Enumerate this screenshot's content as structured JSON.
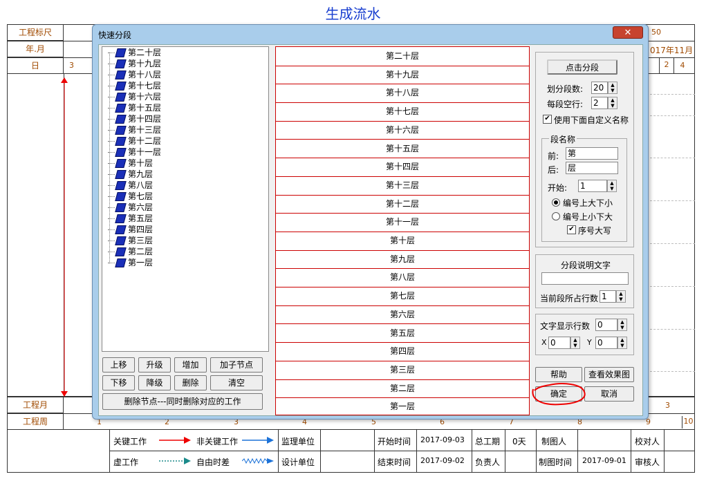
{
  "background": {
    "title": "生成流水",
    "header_labels": [
      "工程标尺",
      "年.月",
      "日"
    ],
    "footer_labels": [
      "工程月",
      "工程周"
    ],
    "header_right": {
      "scale_end": "50",
      "month": "017年11月"
    },
    "day_values": {
      "left": "3",
      "right_a": "2",
      "right_b": "4"
    },
    "month_right": "3",
    "week_numbers": [
      "1",
      "2",
      "3",
      "4",
      "5",
      "6",
      "7",
      "8",
      "9",
      "10"
    ],
    "legend": {
      "critical": "关键工作",
      "noncritical": "非关键工作",
      "dummy": "虚工作",
      "free_float": "自由时差"
    },
    "info": {
      "supervisor_label": "监理单位",
      "designer_label": "设计单位",
      "start_label": "开始时间",
      "start_value": "2017-09-03",
      "end_label": "结束时间",
      "end_value": "2017-09-02",
      "total_label": "总工期",
      "total_value": "0天",
      "owner_label": "负责人",
      "drafter_label": "制图人",
      "draw_time_label": "制图时间",
      "draw_time_value": "2017-09-01",
      "checker_label": "校对人",
      "reviewer_label": "审核人"
    }
  },
  "dialog": {
    "title": "快速分段",
    "close_glyph": "✕",
    "tree_items": [
      "第二十层",
      "第十九层",
      "第十八层",
      "第十七层",
      "第十六层",
      "第十五层",
      "第十四层",
      "第十三层",
      "第十二层",
      "第十一层",
      "第十层",
      "第九层",
      "第八层",
      "第七层",
      "第六层",
      "第五层",
      "第四层",
      "第三层",
      "第二层",
      "第一层"
    ],
    "segments": [
      "第二十层",
      "第十九层",
      "第十八层",
      "第十七层",
      "第十六层",
      "第十五层",
      "第十四层",
      "第十三层",
      "第十二层",
      "第十一层",
      "第十层",
      "第九层",
      "第八层",
      "第七层",
      "第六层",
      "第五层",
      "第四层",
      "第三层",
      "第二层",
      "第一层"
    ],
    "buttons": {
      "up": "上移",
      "promote": "升级",
      "add": "增加",
      "add_child": "加子节点",
      "down": "下移",
      "demote": "降级",
      "delete": "删除",
      "clear": "清空",
      "delete_node": "删除节点---同时删除对应的工作",
      "segment": "点击分段",
      "help": "帮助",
      "preview": "查看效果图",
      "ok": "确定",
      "cancel": "取消"
    },
    "options": {
      "count_label": "划分段数:",
      "count_value": "20",
      "gap_label": "每段空行:",
      "gap_value": "2",
      "use_custom_label": "使用下面自定义名称",
      "use_custom_checked": true,
      "name_group_title": "段名称",
      "prefix_label": "前:",
      "prefix_value": "第",
      "suffix_label": "后:",
      "suffix_value": "层",
      "start_label": "开始:",
      "start_value": "1",
      "order_desc_label": "编号上大下小",
      "order_asc_label": "编号上小下大",
      "order_selected": "desc",
      "uppercase_label": "序号大写",
      "uppercase_checked": true,
      "desc_group_title": "分段说明文字",
      "desc_value": "",
      "rows_label": "当前段所占行数",
      "rows_value": "1",
      "display_rows_label": "文字显示行数",
      "display_rows_value": "0",
      "x_label": "X",
      "x_value": "0",
      "y_label": "Y",
      "y_value": "0"
    }
  }
}
